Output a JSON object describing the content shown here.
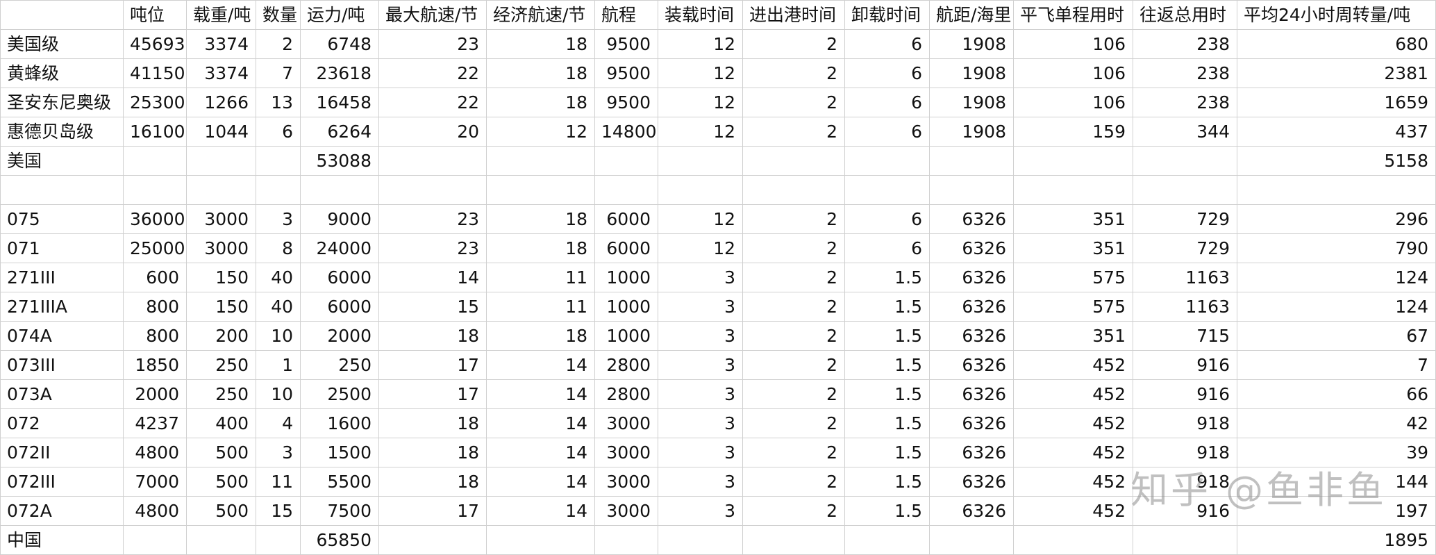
{
  "header": [
    "",
    "吨位",
    "载重/吨",
    "数量",
    "运力/吨",
    "最大航速/节",
    "经济航速/节",
    "航程",
    "装载时间",
    "进出港时间",
    "卸载时间",
    "航距/海里",
    "平飞单程用时",
    "往返总用时",
    "平均24小时周转量/吨"
  ],
  "rows": [
    [
      "美国级",
      "45693",
      "3374",
      "2",
      "6748",
      "23",
      "18",
      "9500",
      "12",
      "2",
      "6",
      "1908",
      "106",
      "238",
      "680"
    ],
    [
      "黄蜂级",
      "41150",
      "3374",
      "7",
      "23618",
      "22",
      "18",
      "9500",
      "12",
      "2",
      "6",
      "1908",
      "106",
      "238",
      "2381"
    ],
    [
      "圣安东尼奥级",
      "25300",
      "1266",
      "13",
      "16458",
      "22",
      "18",
      "9500",
      "12",
      "2",
      "6",
      "1908",
      "106",
      "238",
      "1659"
    ],
    [
      "惠德贝岛级",
      "16100",
      "1044",
      "6",
      "6264",
      "20",
      "12",
      "14800",
      "12",
      "2",
      "6",
      "1908",
      "159",
      "344",
      "437"
    ],
    [
      "美国",
      "",
      "",
      "",
      "53088",
      "",
      "",
      "",
      "",
      "",
      "",
      "",
      "",
      "",
      "5158"
    ],
    [
      "",
      "",
      "",
      "",
      "",
      "",
      "",
      "",
      "",
      "",
      "",
      "",
      "",
      "",
      ""
    ],
    [
      "075",
      "36000",
      "3000",
      "3",
      "9000",
      "23",
      "18",
      "6000",
      "12",
      "2",
      "6",
      "6326",
      "351",
      "729",
      "296"
    ],
    [
      "071",
      "25000",
      "3000",
      "8",
      "24000",
      "23",
      "18",
      "6000",
      "12",
      "2",
      "6",
      "6326",
      "351",
      "729",
      "790"
    ],
    [
      "271III",
      "600",
      "150",
      "40",
      "6000",
      "14",
      "11",
      "1000",
      "3",
      "2",
      "1.5",
      "6326",
      "575",
      "1163",
      "124"
    ],
    [
      "271IIIA",
      "800",
      "150",
      "40",
      "6000",
      "15",
      "11",
      "1000",
      "3",
      "2",
      "1.5",
      "6326",
      "575",
      "1163",
      "124"
    ],
    [
      "074A",
      "800",
      "200",
      "10",
      "2000",
      "18",
      "18",
      "1000",
      "3",
      "2",
      "1.5",
      "6326",
      "351",
      "715",
      "67"
    ],
    [
      "073III",
      "1850",
      "250",
      "1",
      "250",
      "17",
      "14",
      "2800",
      "3",
      "2",
      "1.5",
      "6326",
      "452",
      "916",
      "7"
    ],
    [
      "073A",
      "2000",
      "250",
      "10",
      "2500",
      "17",
      "14",
      "2800",
      "3",
      "2",
      "1.5",
      "6326",
      "452",
      "916",
      "66"
    ],
    [
      "072",
      "4237",
      "400",
      "4",
      "1600",
      "18",
      "14",
      "3000",
      "3",
      "2",
      "1.5",
      "6326",
      "452",
      "918",
      "42"
    ],
    [
      "072II",
      "4800",
      "500",
      "3",
      "1500",
      "18",
      "14",
      "3000",
      "3",
      "2",
      "1.5",
      "6326",
      "452",
      "918",
      "39"
    ],
    [
      "072III",
      "7000",
      "500",
      "11",
      "5500",
      "18",
      "14",
      "3000",
      "3",
      "2",
      "1.5",
      "6326",
      "452",
      "918",
      "144"
    ],
    [
      "072A",
      "4800",
      "500",
      "15",
      "7500",
      "17",
      "14",
      "3000",
      "3",
      "2",
      "1.5",
      "6326",
      "452",
      "916",
      "197"
    ],
    [
      "中国",
      "",
      "",
      "",
      "65850",
      "",
      "",
      "",
      "",
      "",
      "",
      "",
      "",
      "",
      "1895"
    ]
  ],
  "watermark": "知乎 @鱼非鱼"
}
